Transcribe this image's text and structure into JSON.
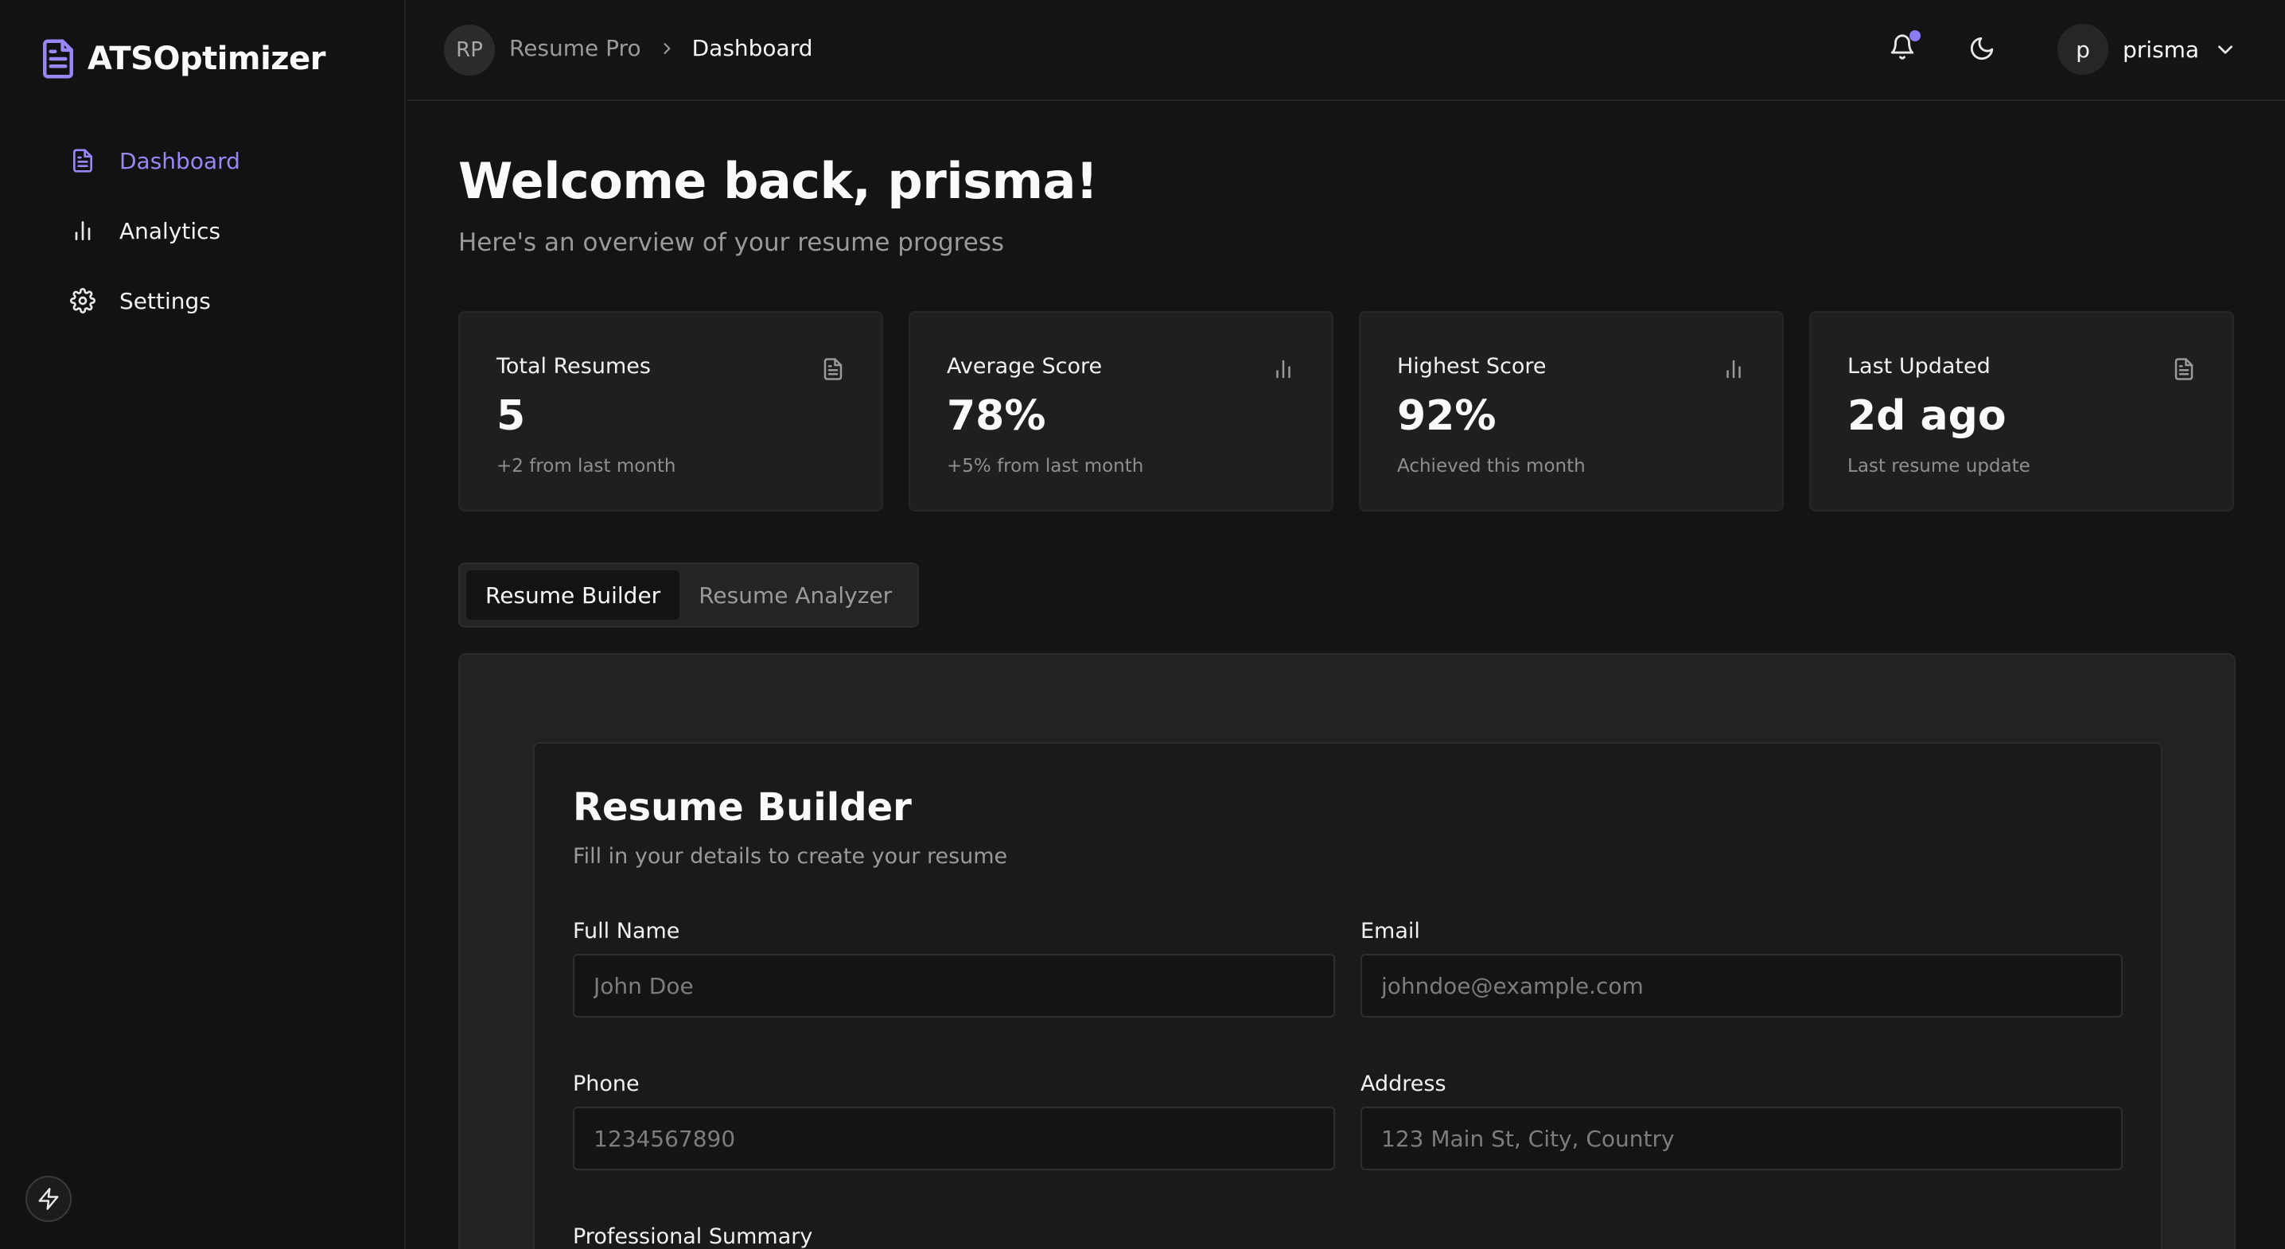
{
  "app": {
    "name": "ATSOptimizer",
    "logo_icon": "file-text-icon",
    "accent_color": "#9b86f5"
  },
  "sidebar": {
    "items": [
      {
        "label": "Dashboard",
        "icon": "file-text-icon",
        "active": true
      },
      {
        "label": "Analytics",
        "icon": "bar-chart-icon",
        "active": false
      },
      {
        "label": "Settings",
        "icon": "gear-icon",
        "active": false
      }
    ],
    "bottom_button_icon": "bolt-icon"
  },
  "header": {
    "breadcrumb_avatar": "RP",
    "breadcrumb_root": "Resume Pro",
    "breadcrumb_current": "Dashboard",
    "notification_icon": "bell-icon",
    "notification_dot_color": "#8b7cf6",
    "theme_toggle_icon": "moon-icon",
    "user": {
      "initial": "p",
      "name": "prisma"
    }
  },
  "main": {
    "title": "Welcome back, prisma!",
    "subtitle": "Here's an overview of your resume progress",
    "stats": [
      {
        "label": "Total Resumes",
        "value": "5",
        "sub": "+2 from last month",
        "icon": "file-text-icon"
      },
      {
        "label": "Average Score",
        "value": "78%",
        "sub": "+5% from last month",
        "icon": "bar-chart-icon"
      },
      {
        "label": "Highest Score",
        "value": "92%",
        "sub": "Achieved this month",
        "icon": "bar-chart-icon"
      },
      {
        "label": "Last Updated",
        "value": "2d ago",
        "sub": "Last resume update",
        "icon": "file-text-icon"
      }
    ],
    "tabs": [
      {
        "label": "Resume Builder",
        "active": true
      },
      {
        "label": "Resume Analyzer",
        "active": false
      }
    ],
    "builder": {
      "title": "Resume Builder",
      "description": "Fill in your details to create your resume",
      "fields": {
        "full_name": {
          "label": "Full Name",
          "placeholder": "John Doe",
          "value": ""
        },
        "email": {
          "label": "Email",
          "placeholder": "johndoe@example.com",
          "value": ""
        },
        "phone": {
          "label": "Phone",
          "placeholder": "1234567890",
          "value": ""
        },
        "address": {
          "label": "Address",
          "placeholder": "123 Main St, City, Country",
          "value": ""
        }
      },
      "summary_label": "Professional Summary"
    }
  }
}
